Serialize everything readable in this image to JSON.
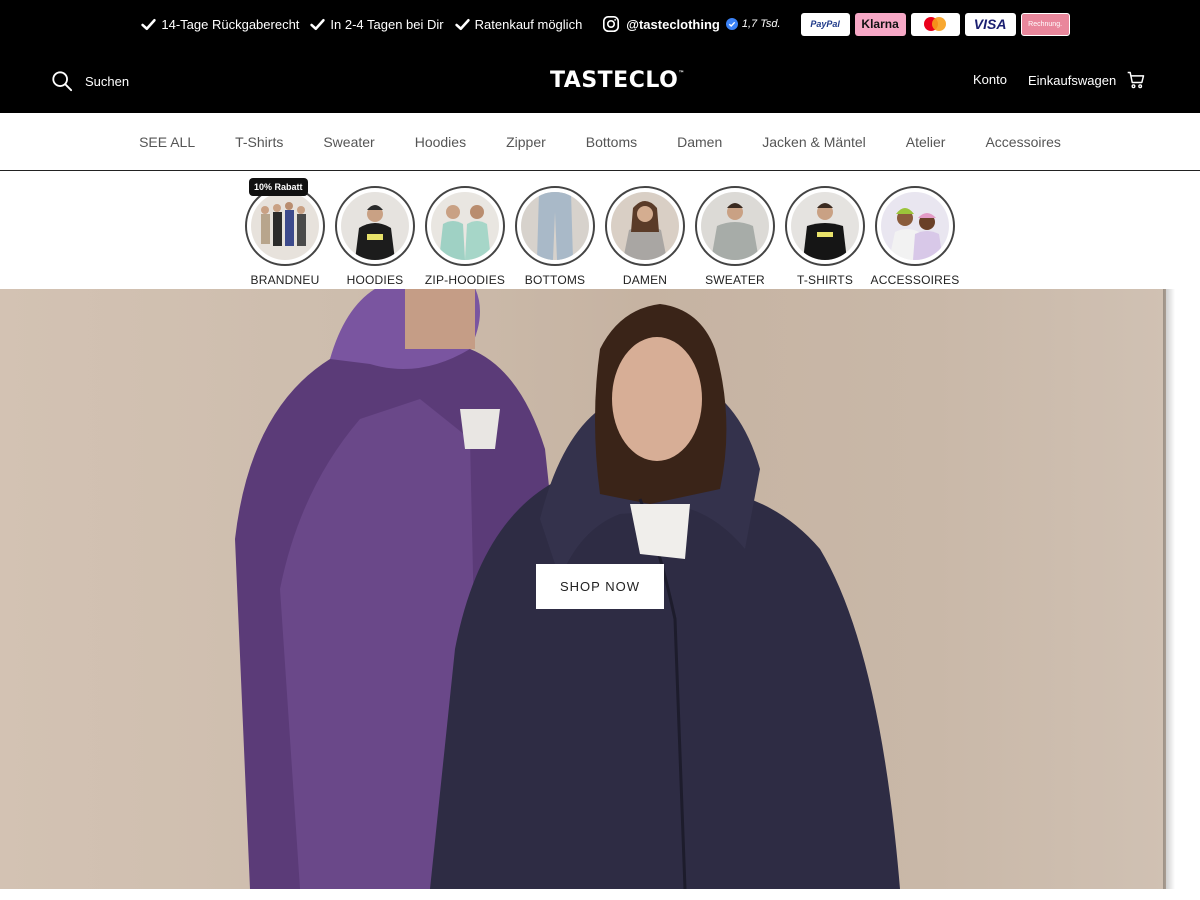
{
  "usps": [
    {
      "label": "14-Tage Rückgaberecht"
    },
    {
      "label": "In 2-4 Tagen bei Dir"
    },
    {
      "label": "Ratenkauf möglich"
    }
  ],
  "instagram": {
    "handle": "@tasteclothing",
    "followers": "1,7 Tsd."
  },
  "payments": {
    "paypal": "PayPal",
    "klarna": "Klarna",
    "visa": "VISA",
    "rechnung": "Rechnung."
  },
  "header": {
    "search_label": "Suchen",
    "logo": "TASTECLO",
    "logo_mark": "™",
    "account_label": "Konto",
    "cart_label": "Einkaufswagen"
  },
  "nav": [
    {
      "label": "SEE ALL"
    },
    {
      "label": "T-Shirts"
    },
    {
      "label": "Sweater"
    },
    {
      "label": "Hoodies"
    },
    {
      "label": "Zipper"
    },
    {
      "label": "Bottoms"
    },
    {
      "label": "Damen"
    },
    {
      "label": "Jacken & Mäntel"
    },
    {
      "label": "Atelier"
    },
    {
      "label": "Accessoires"
    }
  ],
  "stories": [
    {
      "label": "BRANDNEU",
      "badge": "10% Rabatt"
    },
    {
      "label": "HOODIES"
    },
    {
      "label": "ZIP-HOODIES"
    },
    {
      "label": "BOTTOMS"
    },
    {
      "label": "DAMEN"
    },
    {
      "label": "SWEATER"
    },
    {
      "label": "T-SHIRTS"
    },
    {
      "label": "ACCESSOIRES"
    }
  ],
  "hero": {
    "cta_label": "SHOP NOW"
  },
  "colors": {
    "topbar_bg": "#000000",
    "accent_klarna": "#f7a8c6",
    "accent_rechnung": "#e9879c"
  }
}
